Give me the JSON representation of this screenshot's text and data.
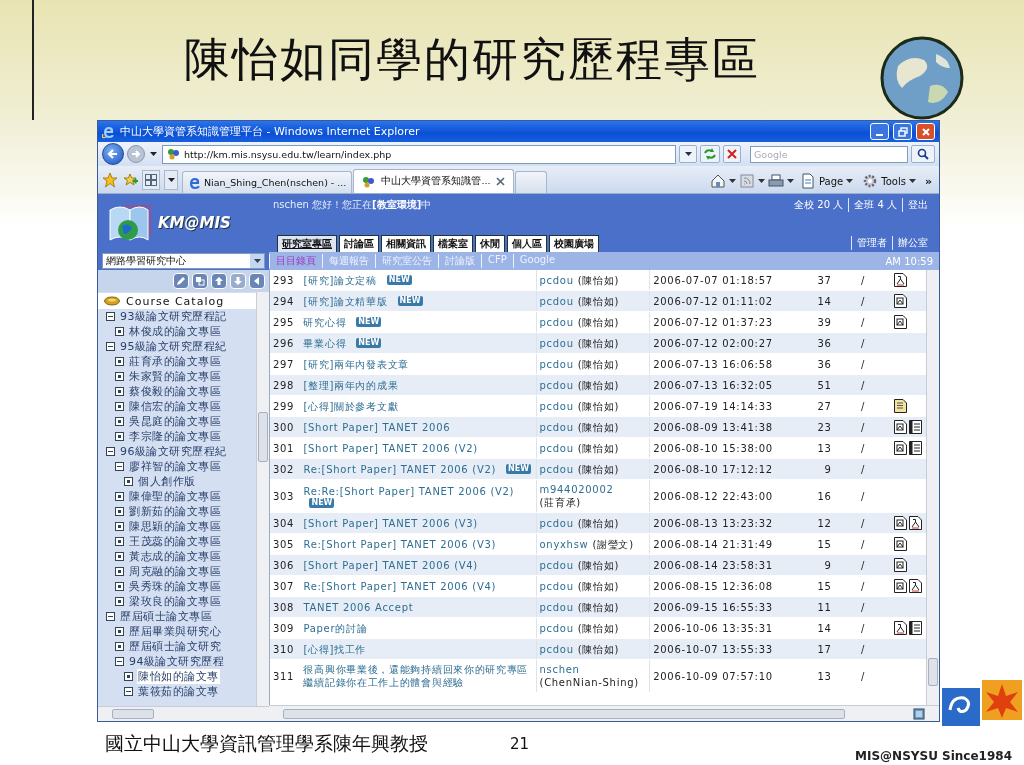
{
  "slide": {
    "title": "陳怡如同學的研究歷程專區",
    "footer_text": "國立中山大學資訊管理學系陳年興教授",
    "page_number": "21",
    "brand": "MIS@NSYSU Since1984"
  },
  "browser": {
    "title": "中山大學資管系知識管理平台 - Windows Internet Explorer",
    "url": "http://km.mis.nsysu.edu.tw/learn/index.php",
    "search_placeholder": "Google",
    "tabs": [
      {
        "label": "Nian_Shing_Chen(nschen) - ...",
        "selected": false
      },
      {
        "label": "中山大學資管系知識管...",
        "selected": true
      }
    ],
    "commands": [
      {
        "kind": "home"
      },
      {
        "kind": "feeds"
      },
      {
        "kind": "print"
      },
      {
        "kind": "page",
        "label": "Page"
      },
      {
        "kind": "tools",
        "label": "Tools"
      },
      {
        "kind": "more",
        "label": "»"
      }
    ]
  },
  "site": {
    "logo": "KM@MIS",
    "greeting": "nschen 您好！您正在**[教室環境]**中",
    "stats": [
      "全校 20 人",
      "全班 4 人",
      "登出"
    ],
    "nav_tabs": [
      {
        "label": "研究室專區",
        "selected": true
      },
      {
        "label": "討論區",
        "selected": false
      },
      {
        "label": "相關資訊",
        "selected": false
      },
      {
        "label": "檔案室",
        "selected": false
      },
      {
        "label": "休閒",
        "selected": false
      },
      {
        "label": "個人區",
        "selected": false
      },
      {
        "label": "校園廣場",
        "selected": false
      }
    ],
    "admin_links": [
      "管理者",
      "辦公室"
    ],
    "section_select": "網路學習研究中心",
    "subnav": [
      {
        "label": "目目錄頁",
        "selected": true
      },
      {
        "label": "每週報告",
        "selected": false
      },
      {
        "label": "研究室公告",
        "selected": false
      },
      {
        "label": "討論版",
        "selected": false
      },
      {
        "label": "CFP",
        "selected": false
      },
      {
        "label": "Google",
        "selected": false
      }
    ],
    "clock": "AM 10:59"
  },
  "tree": {
    "root": "Course Catalog",
    "nodes": [
      {
        "label": "93級論文研究歷程記",
        "expanded": true,
        "selected": false,
        "children": [
          {
            "label": "林俊成的論文專區",
            "expanded": false,
            "selected": false
          }
        ]
      },
      {
        "label": "95級論文研究歷程紀",
        "expanded": true,
        "selected": false,
        "children": [
          {
            "label": "莊育承的論文專區",
            "expanded": false,
            "selected": false
          },
          {
            "label": "朱家賢的論文專區",
            "expanded": false,
            "selected": false
          },
          {
            "label": "蔡俊毅的論文專區",
            "expanded": false,
            "selected": false
          },
          {
            "label": "陳信宏的論文專區",
            "expanded": false,
            "selected": false
          },
          {
            "label": "吳昆庭的論文專區",
            "expanded": false,
            "selected": false
          },
          {
            "label": "李宗隆的論文專區",
            "expanded": false,
            "selected": false
          }
        ]
      },
      {
        "label": "96級論文研究歷程紀",
        "expanded": true,
        "selected": false,
        "children": [
          {
            "label": "廖祥智的論文專區",
            "expanded": true,
            "selected": false,
            "children": [
              {
                "label": "個人創作版",
                "expanded": false,
                "selected": false
              }
            ]
          },
          {
            "label": "陳偉聖的論文專區",
            "expanded": false,
            "selected": false
          },
          {
            "label": "劉新茹的論文專區",
            "expanded": false,
            "selected": false
          },
          {
            "label": "陳思穎的論文專區",
            "expanded": false,
            "selected": false
          },
          {
            "label": "王茂蕊的論文專區",
            "expanded": false,
            "selected": false
          },
          {
            "label": "黃志成的論文專區",
            "expanded": false,
            "selected": false
          },
          {
            "label": "周克融的論文專區",
            "expanded": false,
            "selected": false
          },
          {
            "label": "吳秀珠的論文專區",
            "expanded": false,
            "selected": false
          },
          {
            "label": "梁玫良的論文專區",
            "expanded": false,
            "selected": false
          }
        ]
      },
      {
        "label": "歷屆碩士論文專區",
        "expanded": true,
        "selected": false,
        "children": [
          {
            "label": "歷屆畢業與研究心",
            "expanded": false,
            "selected": false
          },
          {
            "label": "歷屆碩士論文研究",
            "expanded": false,
            "selected": false
          },
          {
            "label": "94級論文研究歷程",
            "expanded": true,
            "selected": false,
            "children": [
              {
                "label": "陳怡如的論文專",
                "expanded": false,
                "selected": true
              },
              {
                "label": "葉筱茹的論文專",
                "expanded": true,
                "selected": false
              }
            ]
          }
        ]
      }
    ]
  },
  "posts": [
    {
      "no": "293",
      "title": "[研究]論文定稿",
      "badge": "NEW",
      "user": "pcdou",
      "name": "(陳怡如)",
      "date": "2006-07-07 01:18:57",
      "count": "37",
      "status": "/",
      "files": [
        {
          "kind": "in"
        }
      ]
    },
    {
      "no": "294",
      "title": "[研究]論文精華版",
      "badge": "NEW",
      "user": "pcdou",
      "name": "(陳怡如)",
      "date": "2006-07-12 01:11:02",
      "count": "14",
      "status": "/",
      "files": [
        {
          "kind": "doc"
        }
      ]
    },
    {
      "no": "295",
      "title": "研究心得",
      "badge": "NEW",
      "user": "pcdou",
      "name": "(陳怡如)",
      "date": "2006-07-12 01:37:23",
      "count": "39",
      "status": "/",
      "files": [
        {
          "kind": "doc"
        }
      ]
    },
    {
      "no": "296",
      "title": "畢業心得",
      "badge": "NEW",
      "user": "pcdou",
      "name": "(陳怡如)",
      "date": "2006-07-12 02:00:27",
      "count": "36",
      "status": "/"
    },
    {
      "no": "297",
      "title": "[研究]兩年內發表文章",
      "user": "pcdou",
      "name": "(陳怡如)",
      "date": "2006-07-13 16:06:58",
      "count": "36",
      "status": "/"
    },
    {
      "no": "298",
      "title": "[整理]兩年內的成果",
      "user": "pcdou",
      "name": "(陳怡如)",
      "date": "2006-07-13 16:32:05",
      "count": "51",
      "status": "/"
    },
    {
      "no": "299",
      "title": "[心得]關於參考文獻",
      "user": "pcdou",
      "name": "(陳怡如)",
      "date": "2006-07-19 14:14:33",
      "count": "27",
      "status": "/",
      "files": [
        {
          "kind": "note"
        }
      ]
    },
    {
      "no": "300",
      "title": "[Short Paper] TANET 2006",
      "user": "pcdou",
      "name": "(陳怡如)",
      "date": "2006-08-09 13:41:38",
      "count": "23",
      "status": "/",
      "files": [
        {
          "kind": "doc"
        },
        {
          "kind": "sheet"
        }
      ]
    },
    {
      "no": "301",
      "title": "[Short Paper] TANET 2006 (V2)",
      "user": "pcdou",
      "name": "(陳怡如)",
      "date": "2006-08-10 15:38:00",
      "count": "13",
      "status": "/",
      "files": [
        {
          "kind": "doc"
        },
        {
          "kind": "sheet"
        }
      ]
    },
    {
      "no": "302",
      "title": "Re:[Short Paper] TANET 2006 (V2)",
      "badge": "NEW",
      "user": "pcdou",
      "name": "(陳怡如)",
      "date": "2006-08-10 17:12:12",
      "count": "9",
      "status": "/"
    },
    {
      "no": "303",
      "title": "Re:Re:[Short Paper] TANET 2006 (V2)",
      "badge": "NEW",
      "user": "m944020002",
      "name": "(莊育承)",
      "date": "2006-08-12 22:43:00",
      "count": "16",
      "status": "/"
    },
    {
      "no": "304",
      "title": "[Short Paper] TANET 2006 (V3)",
      "user": "pcdou",
      "name": "(陳怡如)",
      "date": "2006-08-13 13:23:32",
      "count": "12",
      "status": "/",
      "files": [
        {
          "kind": "doc"
        },
        {
          "kind": "in"
        }
      ]
    },
    {
      "no": "305",
      "title": "Re:[Short Paper] TANET 2006 (V3)",
      "user": "onyxhsw",
      "name": "(謝瑩文)",
      "date": "2006-08-14 21:31:49",
      "count": "15",
      "status": "/",
      "files": [
        {
          "kind": "doc"
        }
      ]
    },
    {
      "no": "306",
      "title": "[Short Paper] TANET 2006 (V4)",
      "user": "pcdou",
      "name": "(陳怡如)",
      "date": "2006-08-14 23:58:31",
      "count": "9",
      "status": "/",
      "files": [
        {
          "kind": "doc"
        }
      ]
    },
    {
      "no": "307",
      "title": "Re:[Short Paper] TANET 2006 (V4)",
      "user": "pcdou",
      "name": "(陳怡如)",
      "date": "2006-08-15 12:36:08",
      "count": "15",
      "status": "/",
      "files": [
        {
          "kind": "doc"
        },
        {
          "kind": "in"
        }
      ]
    },
    {
      "no": "308",
      "title": "TANET 2006 Accept",
      "user": "pcdou",
      "name": "(陳怡如)",
      "date": "2006-09-15 16:55:33",
      "count": "11",
      "status": "/"
    },
    {
      "no": "309",
      "title": "Paper的討論",
      "user": "pcdou",
      "name": "(陳怡如)",
      "date": "2006-10-06 13:35:31",
      "count": "14",
      "status": "/",
      "files": [
        {
          "kind": "in"
        },
        {
          "kind": "sheet"
        }
      ]
    },
    {
      "no": "310",
      "title": "[心得]找工作",
      "user": "pcdou",
      "name": "(陳怡如)",
      "date": "2006-10-07 13:55:33",
      "count": "17",
      "status": "/"
    },
    {
      "no": "311",
      "title": "很高興你畢業後，還能夠持續回來你的研究專區繼續記錄你在工作上的體會與經驗",
      "user": "nschen",
      "name": "(ChenNian-Shing)",
      "date": "2006-10-09 07:57:10",
      "count": "13",
      "status": "/"
    }
  ]
}
